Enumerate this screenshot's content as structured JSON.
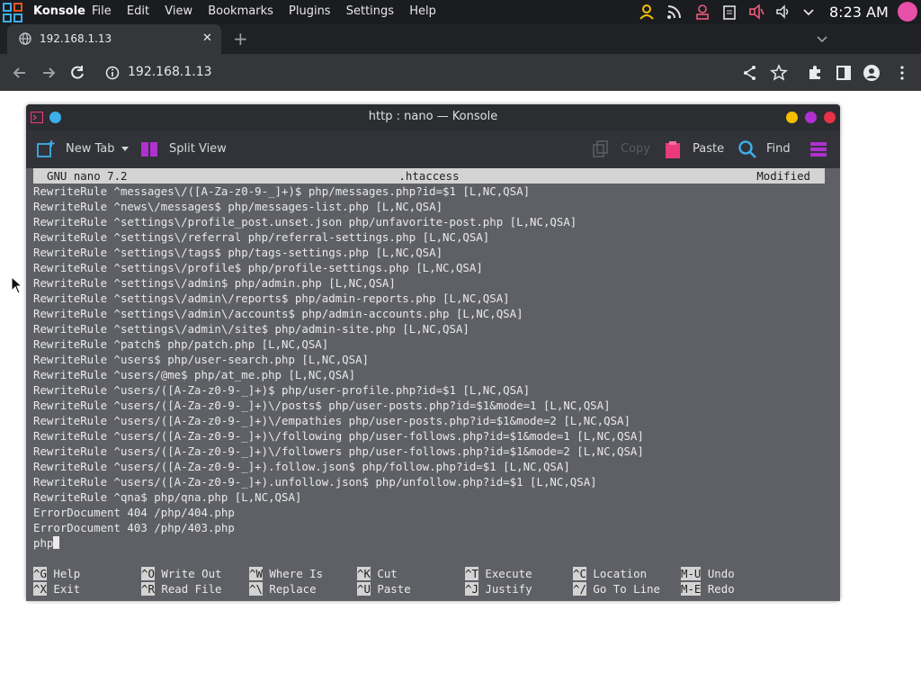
{
  "panel": {
    "app_name": "Konsole",
    "menus": [
      "File",
      "Edit",
      "View",
      "Bookmarks",
      "Plugins",
      "Settings",
      "Help"
    ],
    "clock": "8:23 AM",
    "tray_icons": [
      "user-icon",
      "rss-icon",
      "account-icon",
      "clipboard-icon",
      "microphone-muted-icon",
      "volume-icon",
      "chevron-down-icon"
    ]
  },
  "browser": {
    "tab_title": "192.168.1.13",
    "url": "192.168.1.13"
  },
  "konsole": {
    "title": "http : nano — Konsole",
    "toolbar": {
      "new_tab": "New Tab",
      "split_view": "Split View",
      "copy": "Copy",
      "paste": "Paste",
      "find": "Find"
    },
    "nano": {
      "version": "GNU nano 7.2",
      "filename": ".htaccess",
      "state": "Modified",
      "lines": [
        "RewriteRule ^messages\\/([A-Za-z0-9-_]+)$ php/messages.php?id=$1 [L,NC,QSA]",
        "RewriteRule ^news\\/messages$ php/messages-list.php [L,NC,QSA]",
        "RewriteRule ^settings\\/profile_post.unset.json php/unfavorite-post.php [L,NC,QSA]",
        "RewriteRule ^settings\\/referral php/referral-settings.php [L,NC,QSA]",
        "RewriteRule ^settings\\/tags$ php/tags-settings.php [L,NC,QSA]",
        "RewriteRule ^settings\\/profile$ php/profile-settings.php [L,NC,QSA]",
        "RewriteRule ^settings\\/admin$ php/admin.php [L,NC,QSA]",
        "RewriteRule ^settings\\/admin\\/reports$ php/admin-reports.php [L,NC,QSA]",
        "RewriteRule ^settings\\/admin\\/accounts$ php/admin-accounts.php [L,NC,QSA]",
        "RewriteRule ^settings\\/admin\\/site$ php/admin-site.php [L,NC,QSA]",
        "RewriteRule ^patch$ php/patch.php [L,NC,QSA]",
        "RewriteRule ^users$ php/user-search.php [L,NC,QSA]",
        "RewriteRule ^users/@me$ php/at_me.php [L,NC,QSA]",
        "RewriteRule ^users/([A-Za-z0-9-_]+)$ php/user-profile.php?id=$1 [L,NC,QSA]",
        "RewriteRule ^users/([A-Za-z0-9-_]+)\\/posts$ php/user-posts.php?id=$1&mode=1 [L,NC,QSA]",
        "RewriteRule ^users/([A-Za-z0-9-_]+)\\/empathies php/user-posts.php?id=$1&mode=2 [L,NC,QSA]",
        "RewriteRule ^users/([A-Za-z0-9-_]+)\\/following php/user-follows.php?id=$1&mode=1 [L,NC,QSA]",
        "RewriteRule ^users/([A-Za-z0-9-_]+)\\/followers php/user-follows.php?id=$1&mode=2 [L,NC,QSA]",
        "RewriteRule ^users/([A-Za-z0-9-_]+).follow.json$ php/follow.php?id=$1 [L,NC,QSA]",
        "RewriteRule ^users/([A-Za-z0-9-_]+).unfollow.json$ php/unfollow.php?id=$1 [L,NC,QSA]",
        "RewriteRule ^qna$ php/qna.php [L,NC,QSA]",
        "ErrorDocument 404 /php/404.php",
        "ErrorDocument 403 /php/403.php"
      ],
      "current_line": "php",
      "shortcuts_row1": [
        {
          "key": "^G",
          "label": " Help"
        },
        {
          "key": "^O",
          "label": " Write Out"
        },
        {
          "key": "^W",
          "label": " Where Is"
        },
        {
          "key": "^K",
          "label": " Cut"
        },
        {
          "key": "^T",
          "label": " Execute"
        },
        {
          "key": "^C",
          "label": " Location"
        },
        {
          "key": "M-U",
          "label": " Undo"
        }
      ],
      "shortcuts_row2": [
        {
          "key": "^X",
          "label": " Exit"
        },
        {
          "key": "^R",
          "label": " Read File"
        },
        {
          "key": "^\\",
          "label": " Replace"
        },
        {
          "key": "^U",
          "label": " Paste"
        },
        {
          "key": "^J",
          "label": " Justify"
        },
        {
          "key": "^/",
          "label": " Go To Line"
        },
        {
          "key": "M-E",
          "label": " Redo"
        }
      ]
    }
  }
}
